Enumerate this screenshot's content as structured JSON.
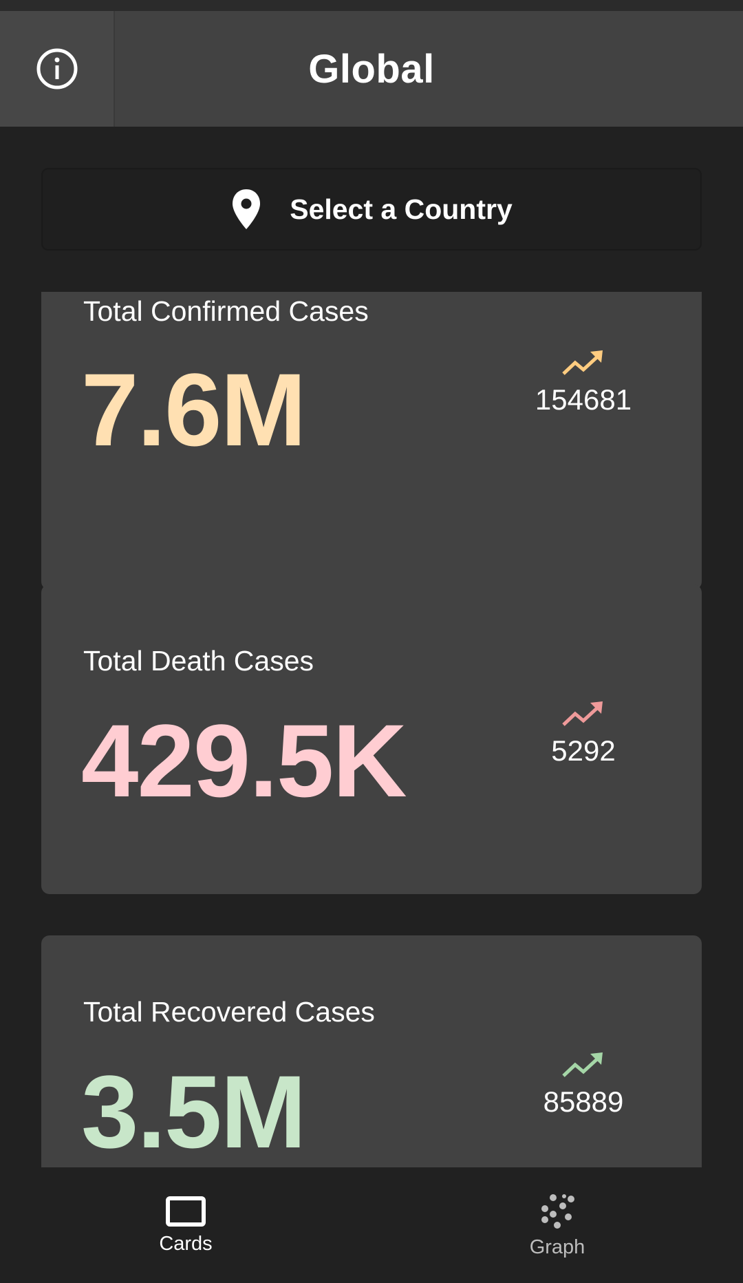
{
  "app_bar": {
    "title": "Global",
    "info_icon": "info-icon"
  },
  "country_button": {
    "label": "Select a Country",
    "icon": "location-pin-icon"
  },
  "cards": [
    {
      "title": "Total Confirmed Cases",
      "value": "7.6M",
      "delta": "154681",
      "color": "#FFE0B2",
      "trend_color": "#FFCC80"
    },
    {
      "title": "Total Death Cases",
      "value": "429.5K",
      "delta": "5292",
      "color": "#FFCDD2",
      "trend_color": "#EF9A9A"
    },
    {
      "title": "Total Recovered Cases",
      "value": "3.5M",
      "delta": "85889",
      "color": "#C8E6C9",
      "trend_color": "#A5D6A7"
    }
  ],
  "bottom_nav": {
    "items": [
      {
        "label": "Cards",
        "icon": "cards-icon",
        "active": true
      },
      {
        "label": "Graph",
        "icon": "graph-icon",
        "active": false
      }
    ]
  }
}
